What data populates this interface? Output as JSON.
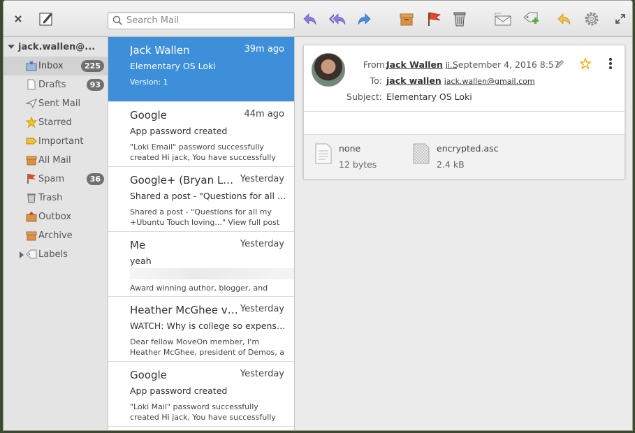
{
  "toolbar": {
    "search_placeholder": "Search Mail"
  },
  "sidebar": {
    "account": "jack.wallen@...",
    "folders": [
      {
        "label": "Inbox",
        "badge": "225",
        "icon": "inbox-icon"
      },
      {
        "label": "Drafts",
        "badge": "93",
        "icon": "drafts-icon"
      },
      {
        "label": "Sent Mail",
        "badge": "",
        "icon": "sent-icon"
      },
      {
        "label": "Starred",
        "badge": "",
        "icon": "star-icon"
      },
      {
        "label": "Important",
        "badge": "",
        "icon": "important-icon"
      },
      {
        "label": "All Mail",
        "badge": "",
        "icon": "all-mail-icon"
      },
      {
        "label": "Spam",
        "badge": "36",
        "icon": "spam-icon"
      },
      {
        "label": "Trash",
        "badge": "",
        "icon": "trash-icon"
      },
      {
        "label": "Outbox",
        "badge": "",
        "icon": "outbox-icon"
      },
      {
        "label": "Archive",
        "badge": "",
        "icon": "archive-icon"
      },
      {
        "label": "Labels",
        "badge": "",
        "icon": "label-icon"
      }
    ]
  },
  "messages": [
    {
      "sender": "Jack Wallen",
      "time": "39m ago",
      "subject": "Elementary OS Loki",
      "preview": "Version: 1"
    },
    {
      "sender": "Google",
      "time": "44m ago",
      "subject": "App password created",
      "preview": "\"Loki Email\" password successfully created Hi jack, You have successfully cre..."
    },
    {
      "sender": "Google+ (Bryan Lun...",
      "time": "Yesterday",
      "subject": "Shared a post - \"Questions for all my +...",
      "preview": "Shared a post - \"Questions for all my +Ubuntu Touch loving...\" View full post t..."
    },
    {
      "sender": "Me",
      "time": "Yesterday",
      "subject": "yeah",
      "preview": "Award winning author, blogger, and pod..."
    },
    {
      "sender": "Heather McGhee via...",
      "time": "Yesterday",
      "subject": "WATCH: Why is college so expensive?",
      "preview": "Dear fellow MoveOn member, I'm Heather McGhee, president of Demos, a ..."
    },
    {
      "sender": "Google",
      "time": "Yesterday",
      "subject": "App password created",
      "preview": "\"Loki Mail\" password successfully created Hi jack, You have successfully created an a"
    }
  ],
  "reader": {
    "from_label": "From:",
    "from_name": "Jack Wallen",
    "from_addr": "ji...",
    "date": "September 4, 2016 8:57",
    "to_label": "To:",
    "to_name": "jack wallen",
    "to_addr": "jack.wallen@gmail.com",
    "subject_label": "Subject:",
    "subject": "Elementary OS Loki",
    "attachments": [
      {
        "name": "none",
        "size": "12 bytes"
      },
      {
        "name": "encrypted.asc",
        "size": "2.4 kB"
      }
    ]
  },
  "colors": {
    "accent": "#3d8fd9",
    "badge": "#707070"
  }
}
